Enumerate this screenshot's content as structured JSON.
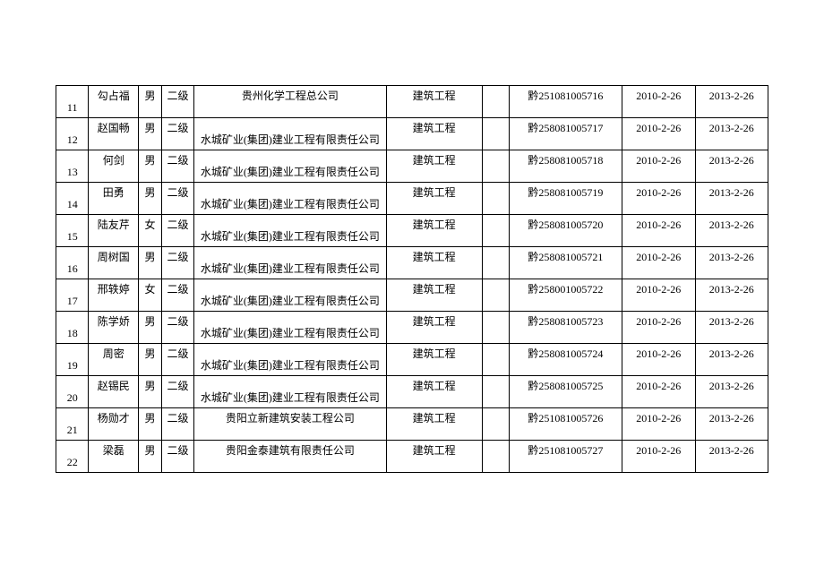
{
  "table": {
    "rows": [
      {
        "idx": "11",
        "name": "勾占福",
        "gender": "男",
        "level": "二级",
        "company": "贵州化学工程总公司",
        "company_align": "top",
        "field": "建筑工程",
        "blank": "",
        "cert": "黔251081005716",
        "d1": "2010-2-26",
        "d2": "2013-2-26"
      },
      {
        "idx": "12",
        "name": "赵国畅",
        "gender": "男",
        "level": "二级",
        "company": "水城矿业(集团)建业工程有限责任公司",
        "company_align": "bottom",
        "field": "建筑工程",
        "blank": "",
        "cert": "黔258081005717",
        "d1": "2010-2-26",
        "d2": "2013-2-26"
      },
      {
        "idx": "13",
        "name": "何剑",
        "gender": "男",
        "level": "二级",
        "company": "水城矿业(集团)建业工程有限责任公司",
        "company_align": "bottom",
        "field": "建筑工程",
        "blank": "",
        "cert": "黔258081005718",
        "d1": "2010-2-26",
        "d2": "2013-2-26"
      },
      {
        "idx": "14",
        "name": "田勇",
        "gender": "男",
        "level": "二级",
        "company": "水城矿业(集团)建业工程有限责任公司",
        "company_align": "bottom",
        "field": "建筑工程",
        "blank": "",
        "cert": "黔258081005719",
        "d1": "2010-2-26",
        "d2": "2013-2-26"
      },
      {
        "idx": "15",
        "name": "陆友芹",
        "gender": "女",
        "level": "二级",
        "company": "水城矿业(集团)建业工程有限责任公司",
        "company_align": "bottom",
        "field": "建筑工程",
        "blank": "",
        "cert": "黔258081005720",
        "d1": "2010-2-26",
        "d2": "2013-2-26"
      },
      {
        "idx": "16",
        "name": "周树国",
        "gender": "男",
        "level": "二级",
        "company": "水城矿业(集团)建业工程有限责任公司",
        "company_align": "bottom",
        "field": "建筑工程",
        "blank": "",
        "cert": "黔258081005721",
        "d1": "2010-2-26",
        "d2": "2013-2-26"
      },
      {
        "idx": "17",
        "name": "邢轶婷",
        "gender": "女",
        "level": "二级",
        "company": "水城矿业(集团)建业工程有限责任公司",
        "company_align": "bottom",
        "field": "建筑工程",
        "blank": "",
        "cert": "黔258001005722",
        "d1": "2010-2-26",
        "d2": "2013-2-26"
      },
      {
        "idx": "18",
        "name": "陈学娇",
        "gender": "男",
        "level": "二级",
        "company": "水城矿业(集团)建业工程有限责任公司",
        "company_align": "bottom",
        "field": "建筑工程",
        "blank": "",
        "cert": "黔258081005723",
        "d1": "2010-2-26",
        "d2": "2013-2-26"
      },
      {
        "idx": "19",
        "name": "周密",
        "gender": "男",
        "level": "二级",
        "company": "水城矿业(集团)建业工程有限责任公司",
        "company_align": "bottom",
        "field": "建筑工程",
        "blank": "",
        "cert": "黔258081005724",
        "d1": "2010-2-26",
        "d2": "2013-2-26"
      },
      {
        "idx": "20",
        "name": "赵锡民",
        "gender": "男",
        "level": "二级",
        "company": "水城矿业(集团)建业工程有限责任公司",
        "company_align": "bottom",
        "field": "建筑工程",
        "blank": "",
        "cert": "黔258081005725",
        "d1": "2010-2-26",
        "d2": "2013-2-26"
      },
      {
        "idx": "21",
        "name": "杨勋才",
        "gender": "男",
        "level": "二级",
        "company": "贵阳立新建筑安装工程公司",
        "company_align": "top",
        "field": "建筑工程",
        "blank": "",
        "cert": "黔251081005726",
        "d1": "2010-2-26",
        "d2": "2013-2-26"
      },
      {
        "idx": "22",
        "name": "梁磊",
        "gender": "男",
        "level": "二级",
        "company": "贵阳金泰建筑有限责任公司",
        "company_align": "top",
        "field": "建筑工程",
        "blank": "",
        "cert": "黔251081005727",
        "d1": "2010-2-26",
        "d2": "2013-2-26"
      }
    ]
  }
}
